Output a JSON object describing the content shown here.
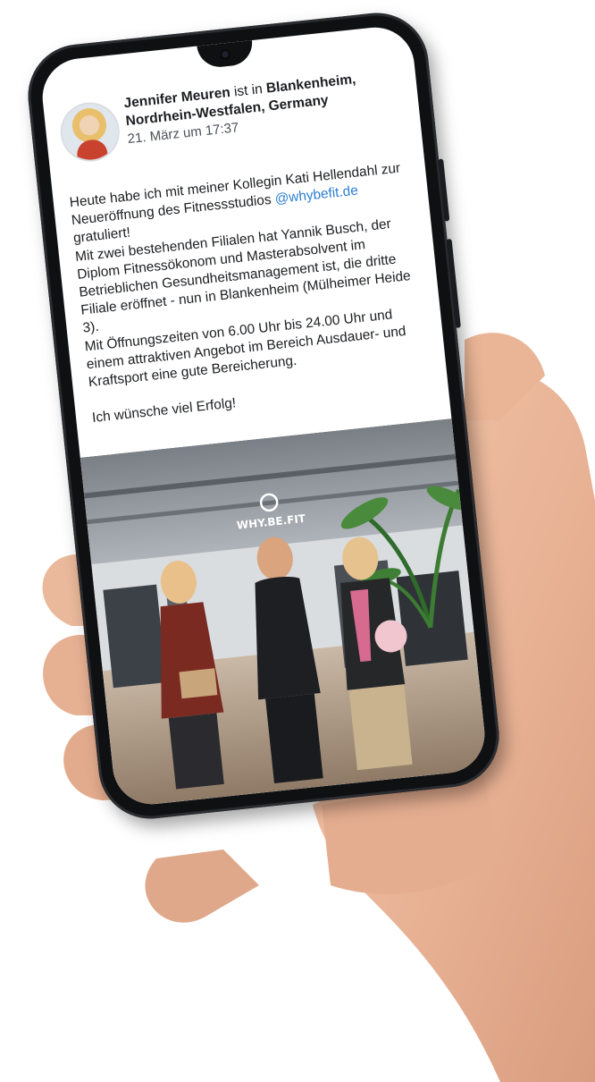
{
  "post": {
    "author": "Jennifer Meuren",
    "location_prefix": "ist in",
    "location": "Blankenheim, Nordrhein-Westfalen, Germany",
    "timestamp": "21. März um 17:37",
    "paragraph_1_a": "Heute habe ich mit meiner Kollegin Kati Hellendahl zur Neueröffnung des Fitnessstudios",
    "mention": "@whybefit.de",
    "paragraph_1_b": "gratuliert!",
    "paragraph_2": "Mit zwei bestehenden Filialen hat Yannik Busch, der Diplom Fitnessökonom und Masterabsolvent im Betrieblichen Gesundheitsmanagement ist, die dritte Filiale eröffnet - nun in Blankenheim (Mülheimer Heide 3).",
    "paragraph_3": "Mit Öffnungszeiten von 6.00 Uhr bis 24.00 Uhr und einem attraktiven Angebot im Bereich Ausdauer- und Kraftsport eine gute Bereicherung.",
    "closing": "Ich wünsche viel Erfolg!"
  },
  "photo": {
    "gym_sign": "WHY.BE.FIT"
  },
  "colors": {
    "mention": "#2d7fd1",
    "phone_frame": "#0f1012",
    "skin": "#eab89a"
  }
}
